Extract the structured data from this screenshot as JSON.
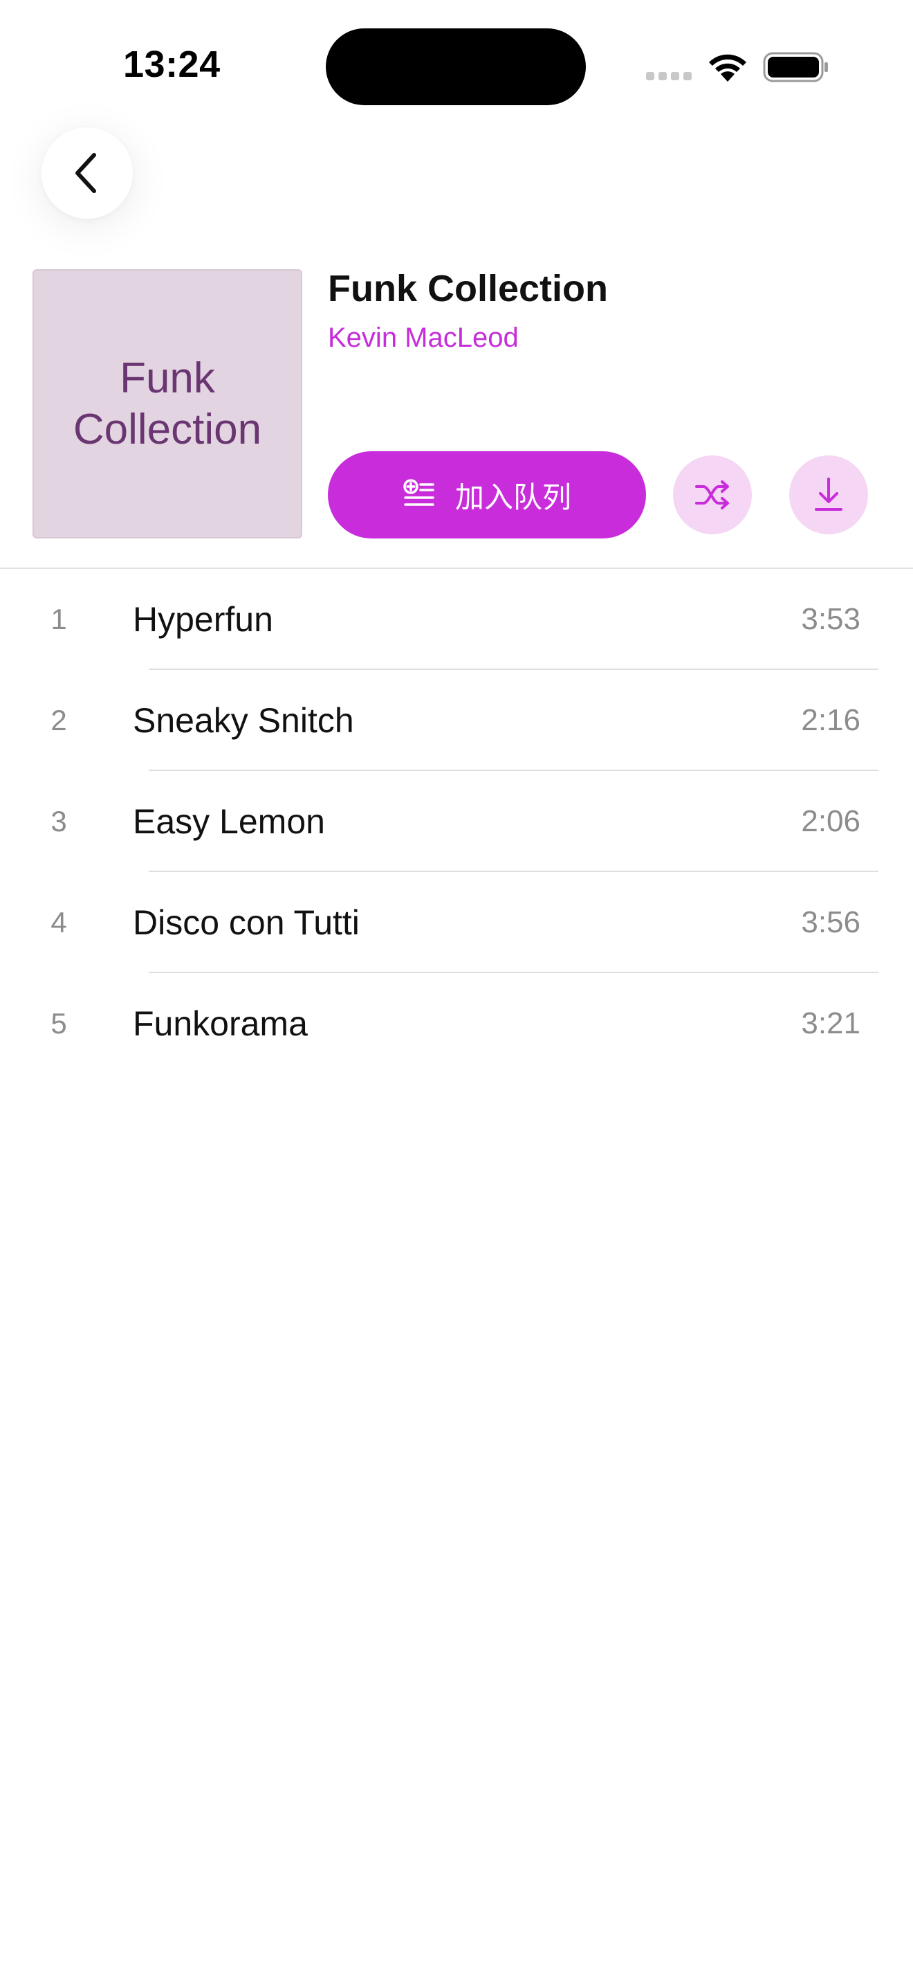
{
  "status_bar": {
    "time": "13:24"
  },
  "album": {
    "artwork_text": "Funk Collection",
    "title": "Funk Collection",
    "artist": "Kevin MacLeod"
  },
  "actions": {
    "queue_label": "加入队列"
  },
  "colors": {
    "accent": "#c92cdb",
    "accent_light": "#f6d6f5",
    "artwork_bg": "#e2d4e1",
    "artwork_text": "#6a3672"
  },
  "icons": {
    "back": "chevron-left-icon",
    "queue": "add-to-queue-icon",
    "shuffle": "shuffle-icon",
    "download": "download-icon"
  },
  "tracks": [
    {
      "number": "1",
      "title": "Hyperfun",
      "duration": "3:53"
    },
    {
      "number": "2",
      "title": "Sneaky Snitch",
      "duration": "2:16"
    },
    {
      "number": "3",
      "title": "Easy Lemon",
      "duration": "2:06"
    },
    {
      "number": "4",
      "title": "Disco con Tutti",
      "duration": "3:56"
    },
    {
      "number": "5",
      "title": "Funkorama",
      "duration": "3:21"
    }
  ]
}
